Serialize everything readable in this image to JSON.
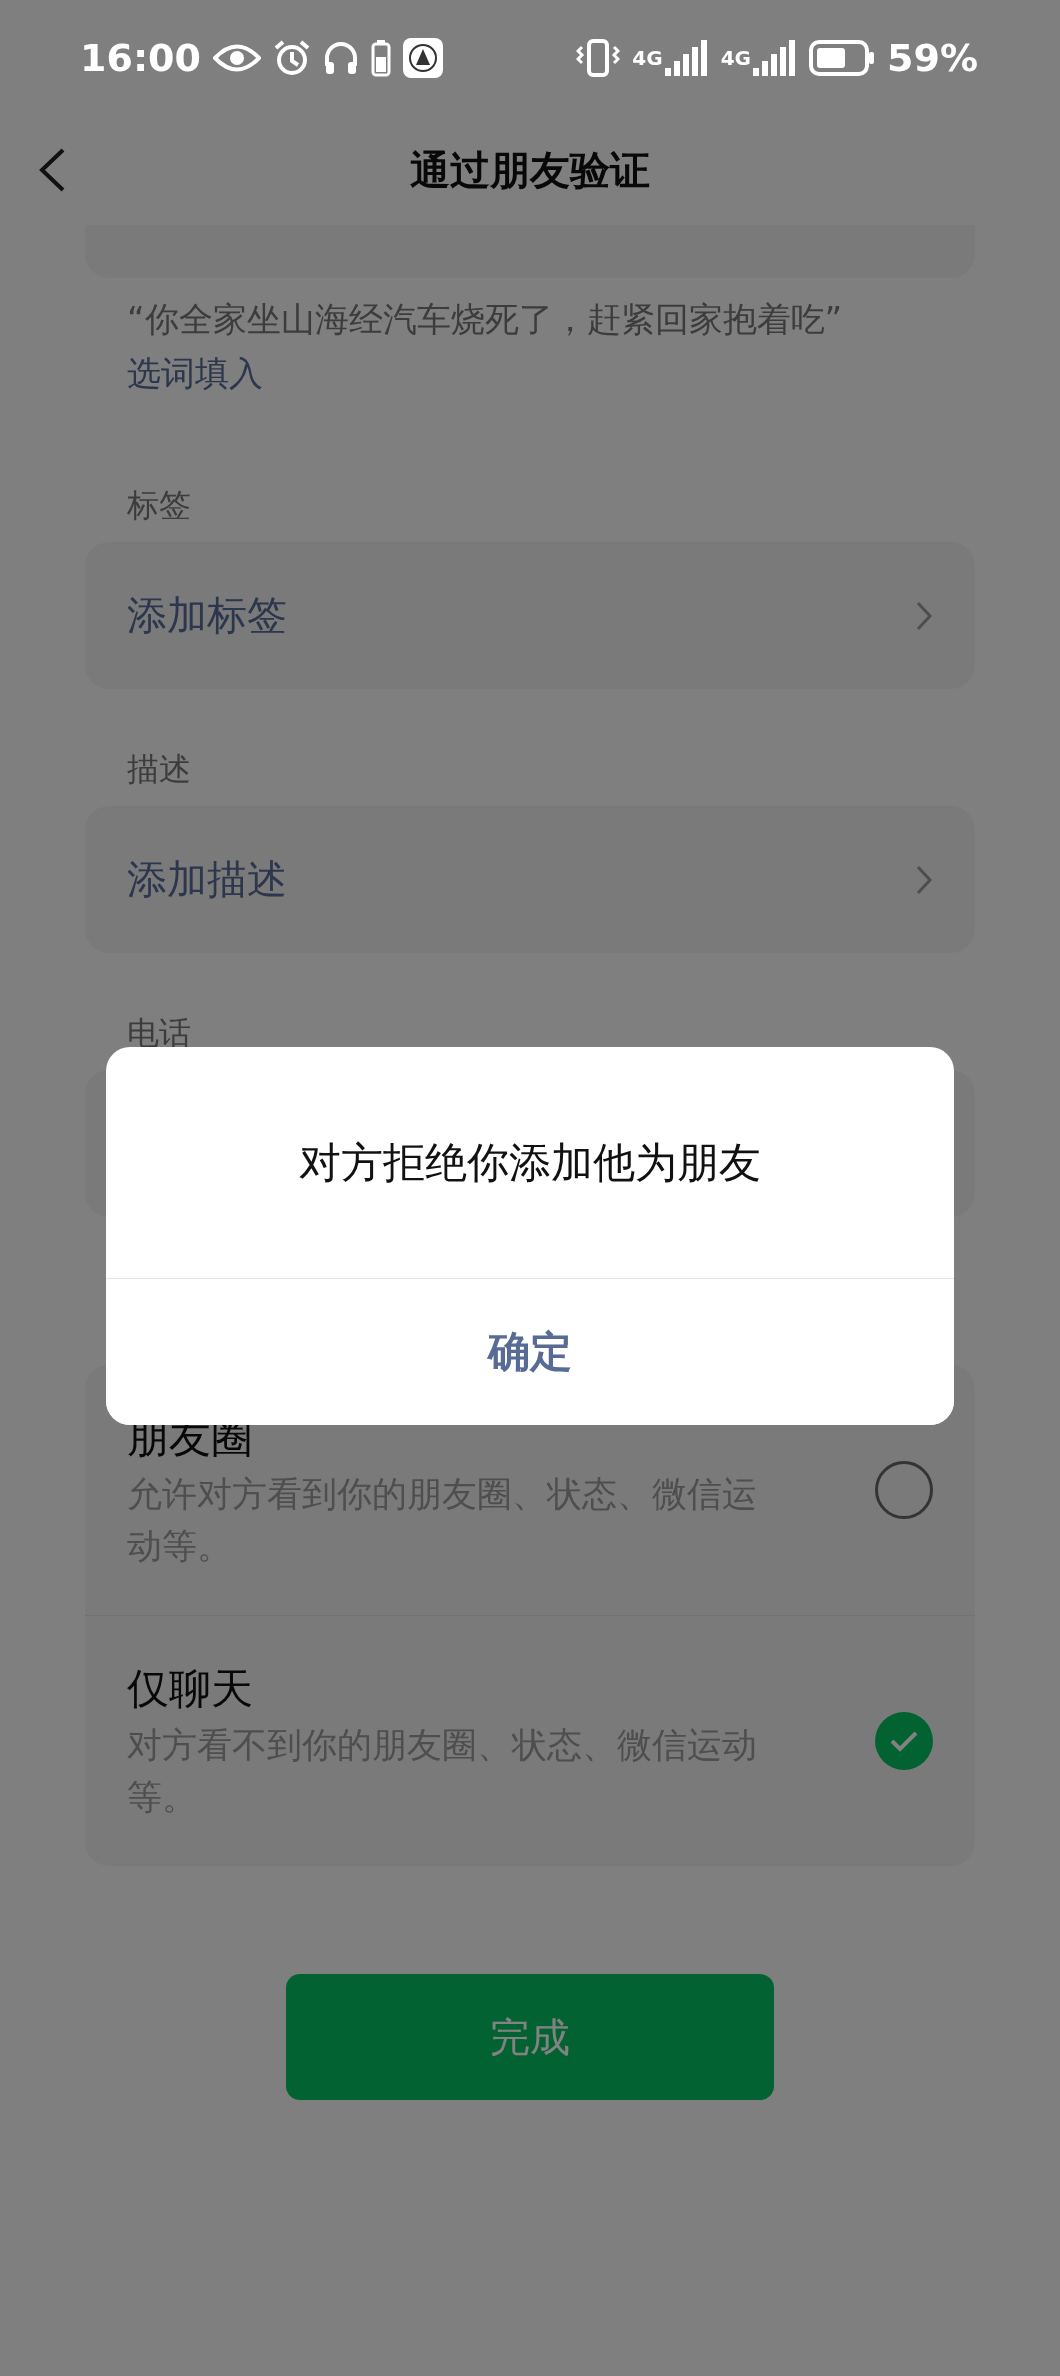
{
  "status_bar": {
    "time": "16:00",
    "network": [
      "4G",
      "4G"
    ],
    "battery": "59%"
  },
  "nav": {
    "title": "通过朋友验证"
  },
  "greeting_hint": {
    "text": "“你全家坐山海经汽车烧死了，赶紧回家抱着吃”",
    "link": "选词填入"
  },
  "sections": [
    {
      "label": "标签",
      "row": "添加标签"
    },
    {
      "label": "描述",
      "row": "添加描述"
    },
    {
      "label": "电话"
    }
  ],
  "permissions": [
    {
      "title": "朋友圈",
      "description": "允许对方看到你的朋友圈、状态、微信运动等。",
      "selected": false
    },
    {
      "title": "仅聊天",
      "description": "对方看不到你的朋友圈、状态、微信运动等。",
      "selected": true
    }
  ],
  "done_button": "完成",
  "dialog": {
    "message": "对方拒绝你添加他为朋友",
    "button": "确定"
  }
}
